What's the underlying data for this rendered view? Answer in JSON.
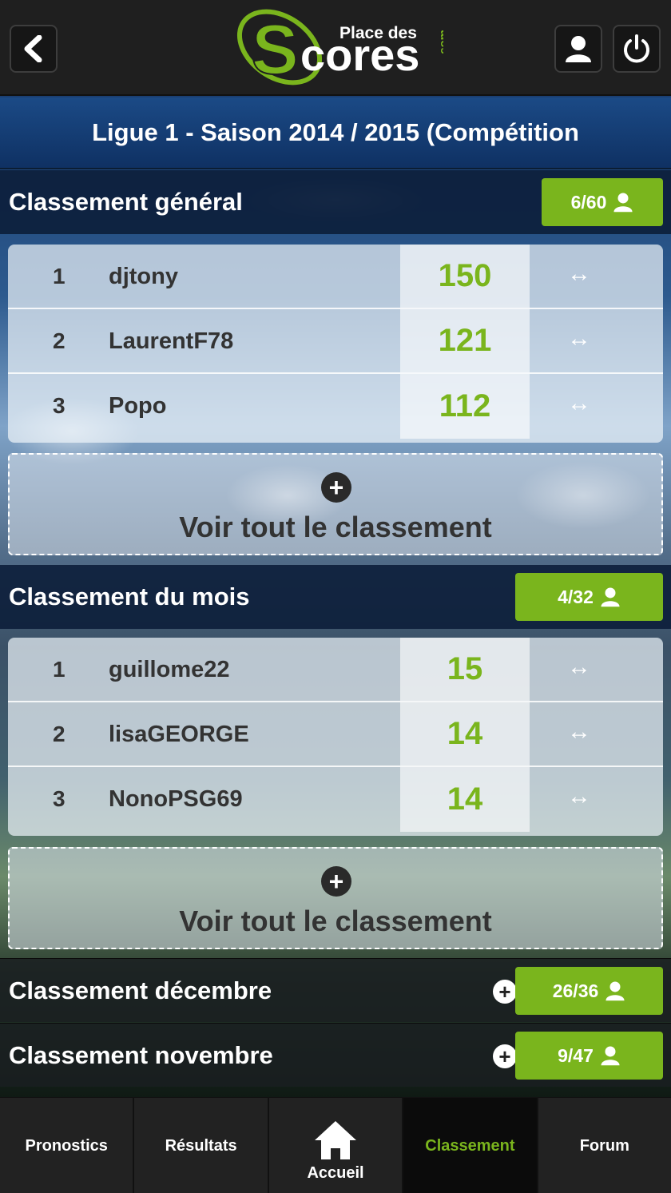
{
  "header": {
    "logo": {
      "small_text": "Place des",
      "big_text": "Scores",
      "domain": ".com"
    },
    "back_icon": "chevron-left-icon",
    "user_icon": "user-icon",
    "power_icon": "power-icon"
  },
  "title": "Ligue 1 - Saison 2014 / 2015 (Compétition",
  "general": {
    "title": "Classement général",
    "badge": "6/60",
    "rows": [
      {
        "rank": "1",
        "name": "djtony",
        "points": "150",
        "trend": "↔"
      },
      {
        "rank": "2",
        "name": "LaurentF78",
        "points": "121",
        "trend": "↔"
      },
      {
        "rank": "3",
        "name": "Popo",
        "points": "112",
        "trend": "↔"
      }
    ],
    "see_all": "Voir tout le classement"
  },
  "month": {
    "title": "Classement du mois",
    "badge": "4/32",
    "rows": [
      {
        "rank": "1",
        "name": "guillome22",
        "points": "15",
        "trend": "↔"
      },
      {
        "rank": "2",
        "name": "lisaGEORGE",
        "points": "14",
        "trend": "↔"
      },
      {
        "rank": "3",
        "name": "NonoPSG69",
        "points": "14",
        "trend": "↔"
      }
    ],
    "see_all": "Voir tout le classement"
  },
  "december": {
    "title": "Classement décembre",
    "badge": "26/36"
  },
  "november": {
    "title": "Classement novembre",
    "badge": "9/47"
  },
  "footer": {
    "tabs": [
      "Pronostics",
      "Résultats",
      "Accueil",
      "Classement",
      "Forum"
    ],
    "active": "Classement"
  },
  "colors": {
    "accent": "#7ab51d",
    "header": "#1f1f1f",
    "title_bar": "#1b4a86"
  }
}
